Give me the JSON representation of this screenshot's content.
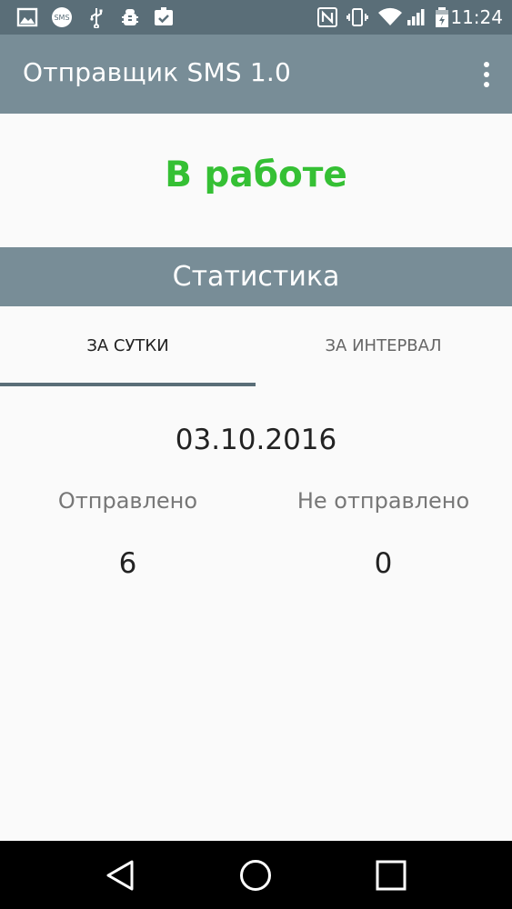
{
  "status_bar": {
    "time": "11:24",
    "icons": [
      "image-icon",
      "sms-icon",
      "usb-icon",
      "android-debug-icon",
      "clipboard-check-icon",
      "nfc-icon",
      "vibrate-icon",
      "wifi-icon",
      "signal-icon",
      "battery-icon"
    ],
    "sms_badge": "SMS"
  },
  "app_bar": {
    "title": "Отправщик SMS 1.0",
    "menu_icon": "more-vert-icon"
  },
  "service": {
    "status": "В работе",
    "status_color": "#35c034"
  },
  "statistics": {
    "header": "Статистика",
    "tabs": [
      {
        "label": "ЗА СУТКИ",
        "selected": true
      },
      {
        "label": "ЗА ИНТЕРВАЛ",
        "selected": false
      }
    ],
    "date": "03.10.2016",
    "sent_label": "Отправлено",
    "sent_value": "6",
    "not_sent_label": "Не отправлено",
    "not_sent_value": "0"
  },
  "nav_bar": {
    "buttons": [
      "back-icon",
      "home-icon",
      "recents-icon"
    ]
  },
  "colors": {
    "primary": "#788d97",
    "primary_dark": "#5a6e78",
    "accent_green": "#35c034"
  }
}
